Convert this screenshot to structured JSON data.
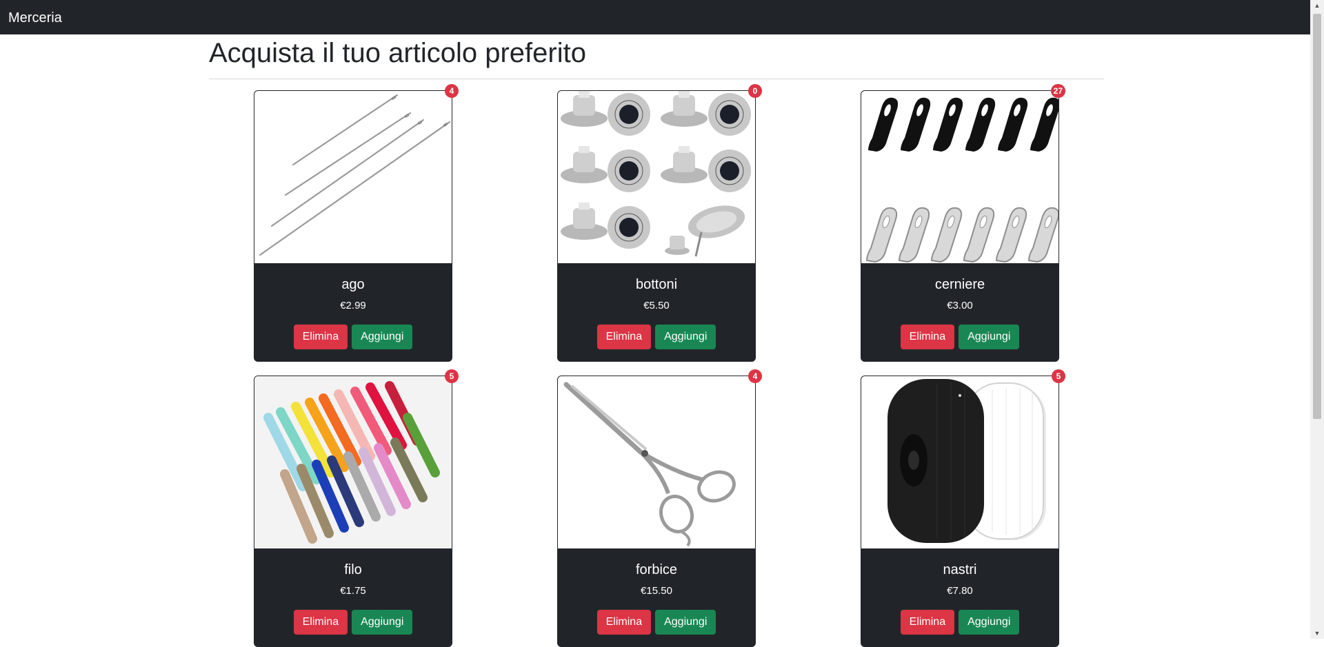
{
  "navbar": {
    "brand": "Merceria"
  },
  "page": {
    "title": "Acquista il tuo articolo preferito"
  },
  "products": [
    {
      "name": "ago",
      "price": "€2.99",
      "count": "4",
      "image": "needles-image",
      "delete_label": "Elimina",
      "add_label": "Aggiungi"
    },
    {
      "name": "bottoni",
      "price": "€5.50",
      "count": "0",
      "image": "jeans-buttons-image",
      "delete_label": "Elimina",
      "add_label": "Aggiungi"
    },
    {
      "name": "cerniere",
      "price": "€3.00",
      "count": "27",
      "image": "zipper-pulls-image",
      "delete_label": "Elimina",
      "add_label": "Aggiungi"
    },
    {
      "name": "filo",
      "price": "€1.75",
      "count": "5",
      "image": "colored-cords-image",
      "delete_label": "Elimina",
      "add_label": "Aggiungi"
    },
    {
      "name": "forbice",
      "price": "€15.50",
      "count": "4",
      "image": "scissors-image",
      "delete_label": "Elimina",
      "add_label": "Aggiungi"
    },
    {
      "name": "nastri",
      "price": "€7.80",
      "count": "5",
      "image": "elastic-bands-image",
      "delete_label": "Elimina",
      "add_label": "Aggiungi"
    }
  ],
  "colors": {
    "navbar": "#212529",
    "danger": "#dc3545",
    "success": "#198754"
  }
}
